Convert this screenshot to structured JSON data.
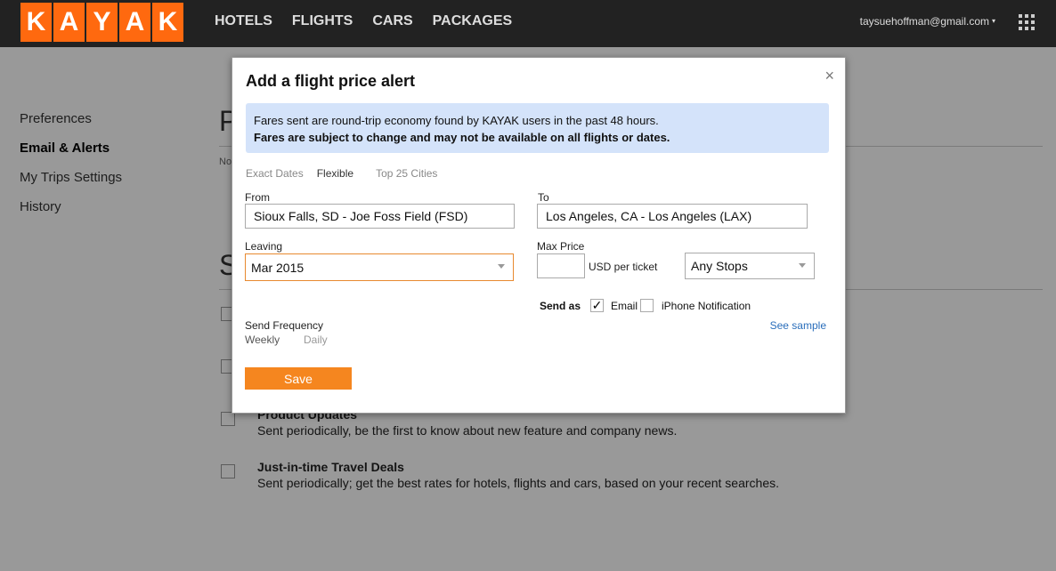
{
  "header": {
    "logo_letters": [
      "K",
      "A",
      "Y",
      "A",
      "K"
    ],
    "nav": [
      "HOTELS",
      "FLIGHTS",
      "CARS",
      "PACKAGES"
    ],
    "user_email": "taysuehoffman@gmail.com",
    "caret": "▾"
  },
  "sidebar": {
    "items": [
      {
        "label": "Preferences"
      },
      {
        "label": "Email & Alerts"
      },
      {
        "label": "My Trips Settings"
      },
      {
        "label": "History"
      }
    ]
  },
  "background": {
    "title_partial": "P",
    "note_partial": "No",
    "section_partial": "S",
    "items": [
      {
        "title": "Product Updates",
        "desc": "Sent periodically, be the first to know about new feature and company news."
      },
      {
        "title": "Just-in-time Travel Deals",
        "desc": "Sent periodically; get the best rates for hotels, flights and cars, based on your recent searches."
      }
    ]
  },
  "modal": {
    "title": "Add a flight price alert",
    "close": "×",
    "info_line1": "Fares sent are round-trip economy found by KAYAK users in the past 48 hours.",
    "info_line2": "Fares are subject to change and may not be available on all flights or dates.",
    "tabs": [
      "Exact Dates",
      "Flexible",
      "Top 25 Cities"
    ],
    "from_label": "From",
    "from_value": "Sioux Falls, SD - Joe Foss Field (FSD)",
    "to_label": "To",
    "to_value": "Los Angeles, CA - Los Angeles (LAX)",
    "leaving_label": "Leaving",
    "leaving_value": "Mar 2015",
    "max_price_label": "Max Price",
    "max_price_value": "",
    "usd_label": "USD per ticket",
    "stops_value": "Any Stops",
    "send_as_label": "Send as",
    "email_label": "Email",
    "email_checked": true,
    "check_mark": "✓",
    "iphone_label": "iPhone Notification",
    "iphone_checked": false,
    "see_sample": "See sample",
    "frequency_label": "Send Frequency",
    "frequency_options": [
      "Weekly",
      "Daily"
    ],
    "save_label": "Save"
  }
}
